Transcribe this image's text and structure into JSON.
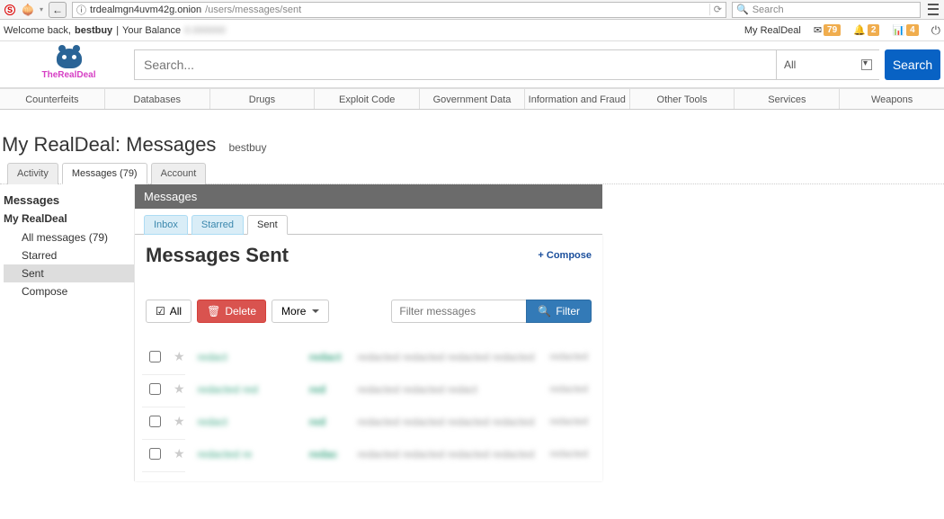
{
  "browser": {
    "url_host": "trdealmgn4uvm42g.onion",
    "url_path": "/users/messages/sent",
    "search_placeholder": "Search"
  },
  "infobar": {
    "welcome": "Welcome back,",
    "user": "bestbuy",
    "balance_label": "Your Balance",
    "my_link": "My RealDeal",
    "mail_count": "79",
    "notif_count": "2",
    "orders_count": "4"
  },
  "logo": {
    "text": "TheRealDeal"
  },
  "search": {
    "placeholder": "Search...",
    "category": "All",
    "button": "Search"
  },
  "categories": [
    "Counterfeits",
    "Databases",
    "Drugs",
    "Exploit Code",
    "Government Data",
    "Information and Fraud",
    "Other Tools",
    "Services",
    "Weapons"
  ],
  "page": {
    "title": "My RealDeal: Messages",
    "user": "bestbuy"
  },
  "outer_tabs": {
    "activity": "Activity",
    "messages": "Messages (79)",
    "account": "Account"
  },
  "sidebar": {
    "heading": "Messages",
    "section": "My RealDeal",
    "items": {
      "all": "All messages (79)",
      "starred": "Starred",
      "sent": "Sent",
      "compose": "Compose"
    }
  },
  "panel": {
    "header": "Messages",
    "tabs": {
      "inbox": "Inbox",
      "starred": "Starred",
      "sent": "Sent"
    },
    "title": "Messages Sent",
    "compose": "+ Compose",
    "all_btn": "All",
    "delete_btn": "Delete",
    "more_btn": "More",
    "filter_placeholder": "Filter messages",
    "filter_btn": "Filter"
  },
  "messages": [
    {
      "name": "redact",
      "tag": "redact",
      "text": "redacted redacted redacted redacted",
      "date": "redacted"
    },
    {
      "name": "redacted red",
      "tag": "red",
      "text": "redacted redacted redact",
      "date": "redacted"
    },
    {
      "name": "redact",
      "tag": "red",
      "text": "redacted redacted redacted redacted redact",
      "date": "redacted"
    },
    {
      "name": "redacted re",
      "tag": "redac",
      "text": "redacted redacted redacted redacted re",
      "date": "redacted"
    }
  ]
}
